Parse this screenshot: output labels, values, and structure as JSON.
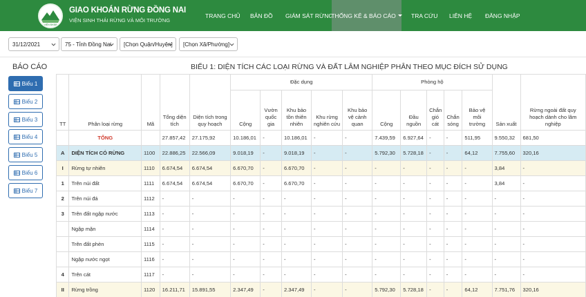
{
  "header": {
    "title": "GIAO KHOÁN RỪNG ĐỒNG NAI",
    "subtitle": "VIỆN SINH THÁI RỪNG VÀ MÔI TRƯỜNG",
    "logo_text": "VIỆN ĐKĐB",
    "nav": [
      "TRANG CHỦ",
      "BẢN ĐỒ",
      "GIÁM SÁT RỪNG",
      "THỐNG KÊ & BÁO CÁO",
      "TRA CỨU",
      "LIÊN HỆ",
      "ĐĂNG NHẬP"
    ]
  },
  "filters": {
    "date": "31/12/2021",
    "province": "75 - Tỉnh Đồng Nai",
    "district": "[Chọn Quận/Huyện]",
    "ward": "[Chọn Xã/Phường]"
  },
  "sidebar": {
    "title": "BÁO CÁO",
    "items": [
      "Biểu 1",
      "Biểu 2",
      "Biểu 3",
      "Biểu 4",
      "Biểu 5",
      "Biểu 6",
      "Biểu 7"
    ]
  },
  "report": {
    "title": "BIỂU 1: DIỆN TÍCH CÁC LOẠI RỪNG VÀ ĐẤT LÂM NGHIỆP PHÂN THEO MỤC ĐÍCH SỬ DỤNG",
    "group_headers": {
      "dac_dung": "Đặc dụng",
      "phong_ho": "Phòng hộ"
    },
    "headers": {
      "tt": "TT",
      "phan_loai": "Phân loại rừng",
      "ma": "Mã",
      "tong_dt": "Tổng diện tích",
      "dt_quy_hoach": "Diện tích trong quy hoạch",
      "dd_cong": "Cộng",
      "dd_vuon": "Vườn quốc gia",
      "dd_kbttn": "Khu bảo tồn thiên nhiên",
      "dd_kncu": "Khu rừng nghiên cứu",
      "dd_kbvcq": "Khu bảo vệ cảnh quan",
      "ph_cong": "Cộng",
      "ph_dau_nguon": "Đầu nguồn",
      "ph_chan_gio": "Chắn gió cát",
      "ph_chan_song": "Chắn sóng",
      "ph_bvmt": "Bảo vệ môi trường",
      "san_xuat": "Sản xuất",
      "ngoai_qh": "Rừng ngoài đất quy hoạch dành cho lâm nghiệp"
    },
    "rows": [
      {
        "tt": "",
        "name": "TỔNG",
        "ma": "",
        "tong": "27.857,42",
        "qh": "27.175,92",
        "ddc": "10.186,01",
        "vqg": "-",
        "kbt": "10.186,01",
        "knc": "-",
        "kcq": "-",
        "phc": "7.439,59",
        "dn": "6.927,64",
        "cg": "-",
        "cs": "-",
        "bv": "511,95",
        "sx": "9.550,32",
        "nq": "681,50"
      },
      {
        "tt": "A",
        "name": "DIỆN TÍCH CÓ RỪNG",
        "ma": "1100",
        "tong": "22.886,25",
        "qh": "22.566,09",
        "ddc": "9.018,19",
        "vqg": "-",
        "kbt": "9.018,19",
        "knc": "-",
        "kcq": "-",
        "phc": "5.792,30",
        "dn": "5.728,18",
        "cg": "-",
        "cs": "-",
        "bv": "64,12",
        "sx": "7.755,60",
        "nq": "320,16"
      },
      {
        "tt": "I",
        "name": "Rừng tự nhiên",
        "ma": "1110",
        "tong": "6.674,54",
        "qh": "6.674,54",
        "ddc": "6.670,70",
        "vqg": "-",
        "kbt": "6.670,70",
        "knc": "-",
        "kcq": "-",
        "phc": "-",
        "dn": "-",
        "cg": "-",
        "cs": "-",
        "bv": "-",
        "sx": "3,84",
        "nq": "-"
      },
      {
        "tt": "1",
        "name": "Trên núi đất",
        "ma": "1111",
        "tong": "6.674,54",
        "qh": "6.674,54",
        "ddc": "6.670,70",
        "vqg": "-",
        "kbt": "6.670,70",
        "knc": "-",
        "kcq": "-",
        "phc": "-",
        "dn": "-",
        "cg": "-",
        "cs": "-",
        "bv": "-",
        "sx": "3,84",
        "nq": "-"
      },
      {
        "tt": "2",
        "name": "Trên núi đá",
        "ma": "1112",
        "tong": "-",
        "qh": "-",
        "ddc": "-",
        "vqg": "-",
        "kbt": "-",
        "knc": "-",
        "kcq": "-",
        "phc": "-",
        "dn": "-",
        "cg": "-",
        "cs": "-",
        "bv": "-",
        "sx": "-",
        "nq": "-"
      },
      {
        "tt": "3",
        "name": "Trên đất ngập nước",
        "ma": "1113",
        "tong": "-",
        "qh": "-",
        "ddc": "-",
        "vqg": "-",
        "kbt": "-",
        "knc": "-",
        "kcq": "-",
        "phc": "-",
        "dn": "-",
        "cg": "-",
        "cs": "-",
        "bv": "-",
        "sx": "-",
        "nq": "-"
      },
      {
        "tt": "",
        "name": "Ngập mặn",
        "ma": "1114",
        "tong": "-",
        "qh": "-",
        "ddc": "-",
        "vqg": "-",
        "kbt": "-",
        "knc": "-",
        "kcq": "-",
        "phc": "-",
        "dn": "-",
        "cg": "-",
        "cs": "-",
        "bv": "-",
        "sx": "-",
        "nq": "-"
      },
      {
        "tt": "",
        "name": "Trên đất phèn",
        "ma": "1115",
        "tong": "-",
        "qh": "-",
        "ddc": "-",
        "vqg": "-",
        "kbt": "-",
        "knc": "-",
        "kcq": "-",
        "phc": "-",
        "dn": "-",
        "cg": "-",
        "cs": "-",
        "bv": "-",
        "sx": "-",
        "nq": "-"
      },
      {
        "tt": "",
        "name": "Ngập nước ngọt",
        "ma": "1116",
        "tong": "-",
        "qh": "-",
        "ddc": "-",
        "vqg": "-",
        "kbt": "-",
        "knc": "-",
        "kcq": "-",
        "phc": "-",
        "dn": "-",
        "cg": "-",
        "cs": "-",
        "bv": "-",
        "sx": "-",
        "nq": "-"
      },
      {
        "tt": "4",
        "name": "Trên cát",
        "ma": "1117",
        "tong": "-",
        "qh": "-",
        "ddc": "-",
        "vqg": "-",
        "kbt": "-",
        "knc": "-",
        "kcq": "-",
        "phc": "-",
        "dn": "-",
        "cg": "-",
        "cs": "-",
        "bv": "-",
        "sx": "-",
        "nq": "-"
      },
      {
        "tt": "II",
        "name": "Rừng trồng",
        "ma": "1120",
        "tong": "16.211,71",
        "qh": "15.891,55",
        "ddc": "2.347,49",
        "vqg": "-",
        "kbt": "2.347,49",
        "knc": "-",
        "kcq": "-",
        "phc": "5.792,30",
        "dn": "5.728,18",
        "cg": "-",
        "cs": "-",
        "bv": "64,12",
        "sx": "7.751,76",
        "nq": "320,16"
      }
    ]
  },
  "colors": {
    "header_green": "#2d8a3f",
    "accent_blue": "#2f6db0",
    "row_highlight": "#d6ebf3",
    "row_yellow": "#fbf7e4",
    "total_red": "#d03a2c"
  }
}
